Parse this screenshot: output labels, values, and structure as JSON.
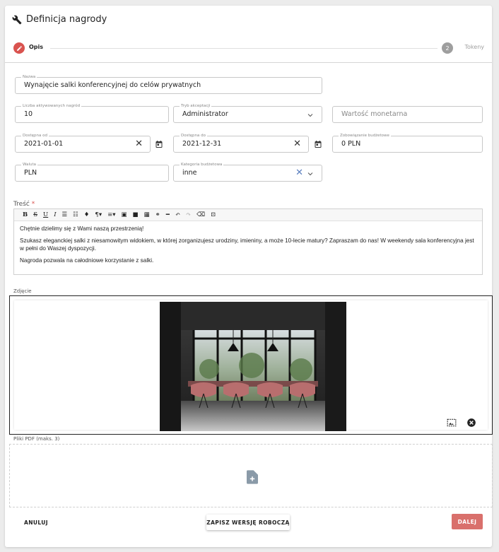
{
  "header": {
    "icon": "wrench-icon",
    "title": "Definicja nagrody"
  },
  "stepper": {
    "steps": [
      {
        "label": "Opis",
        "marker": "",
        "state": "active",
        "icon": "pencil-icon"
      },
      {
        "label": "Tokeny",
        "marker": "2",
        "state": "inactive"
      }
    ],
    "active_color": "#d9534f"
  },
  "form": {
    "nazwa": {
      "label": "Nazwa",
      "value": "Wynajęcie salki konferencyjnej do celów prywatnych"
    },
    "liczba": {
      "label": "Liczba aktywowanych nagród",
      "value": "10"
    },
    "tryb": {
      "label": "Tryb akceptacji",
      "value": "Administrator"
    },
    "wartosc": {
      "placeholder": "Wartość monetarna"
    },
    "od": {
      "label": "Dostępna od",
      "value": "2021-01-01"
    },
    "do": {
      "label": "Dostępna do",
      "value": "2021-12-31"
    },
    "zobowiazanie": {
      "label": "Zobowiązanie budżetowe",
      "value": "0 PLN"
    },
    "waluta": {
      "label": "Waluta",
      "value": "PLN"
    },
    "kategoria": {
      "label": "Kategoria budżetowa",
      "value": "inne"
    }
  },
  "content": {
    "label": "Treść",
    "required_mark": "*",
    "toolbar": [
      "B",
      "S",
      "U",
      "I",
      "☰",
      "☷",
      "♦",
      "¶▾",
      "≡▾",
      "▣",
      "■",
      "▦",
      "⚭",
      "━",
      "↶",
      "↷",
      "⌫",
      "⊡"
    ],
    "paragraphs": [
      "Chętnie dzielimy się z Wami naszą przestrzenią!",
      "Szukasz eleganckiej salki z niesamowitym widokiem, w której zorganizujesz urodziny, imieniny, a może 10-lecie matury? Zapraszam do nas! W weekendy sala konferencyjna jest w pełni do Waszej dyspozycji.",
      "Nagroda pozwala na całodniowe korzystanie z salki."
    ]
  },
  "photo": {
    "label": "Zdjęcie",
    "alt": "conference-room-photo",
    "actions": [
      "change-image-icon",
      "remove-image-icon"
    ]
  },
  "pdf": {
    "label": "Pliki PDF (maks. 3)",
    "icon": "add-file-icon"
  },
  "buttons": {
    "cancel": "ANULUJ",
    "draft": "ZAPISZ WERSJĘ ROBOCZĄ",
    "next": "DALEJ"
  }
}
